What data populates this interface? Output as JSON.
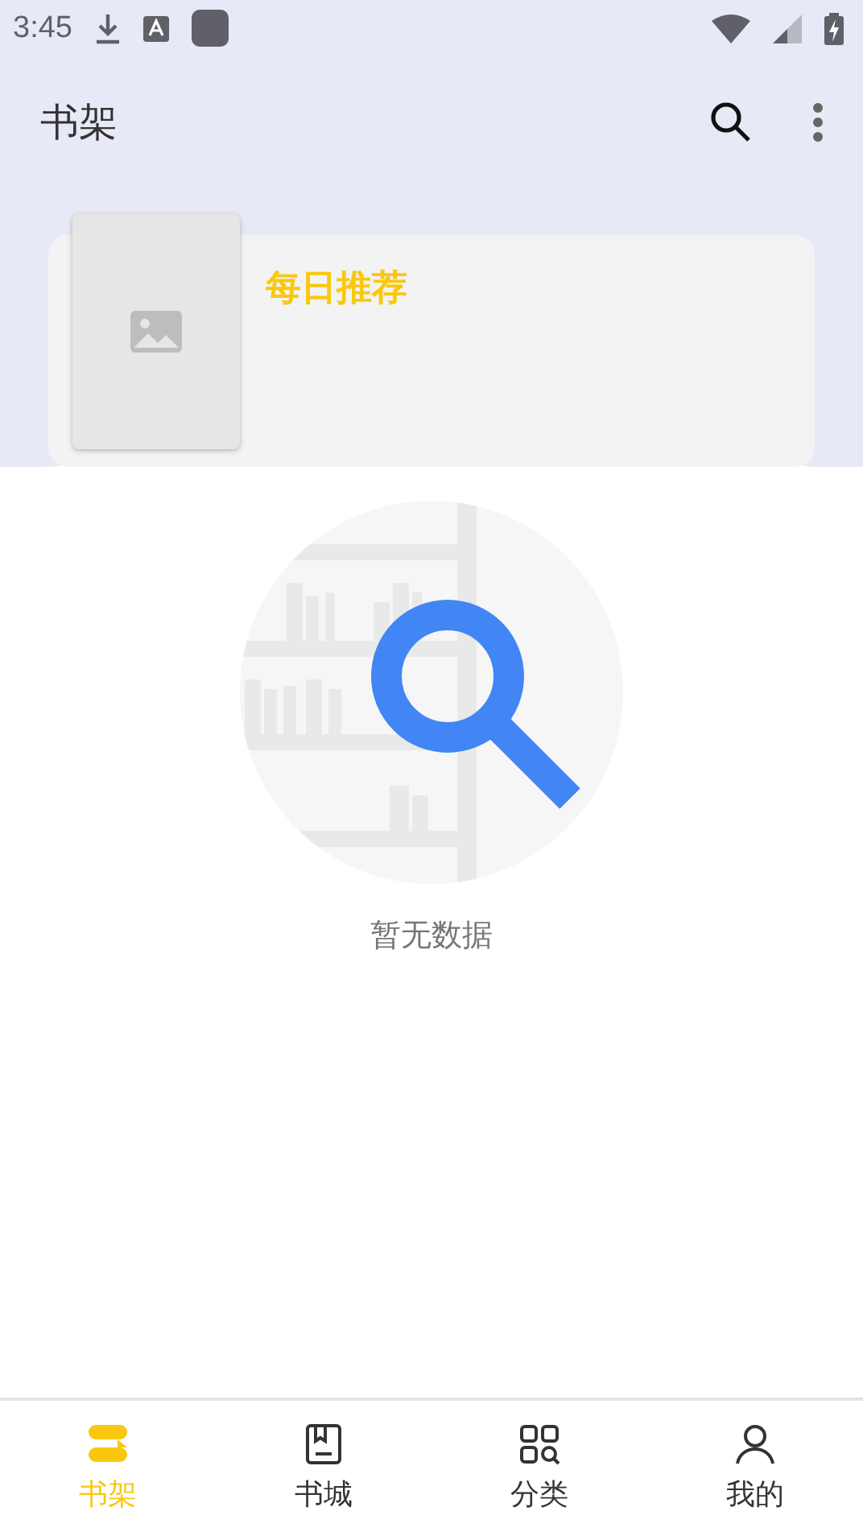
{
  "status_bar": {
    "time": "3:45"
  },
  "app_bar": {
    "title": "书架"
  },
  "daily_card": {
    "title": "每日推荐"
  },
  "empty_state": {
    "message": "暂无数据"
  },
  "bottom_nav": [
    {
      "label": "书架",
      "kind": "shelf",
      "selected": true
    },
    {
      "label": "书城",
      "kind": "store",
      "selected": false
    },
    {
      "label": "分类",
      "kind": "category",
      "selected": false
    },
    {
      "label": "我的",
      "kind": "profile",
      "selected": false
    }
  ]
}
